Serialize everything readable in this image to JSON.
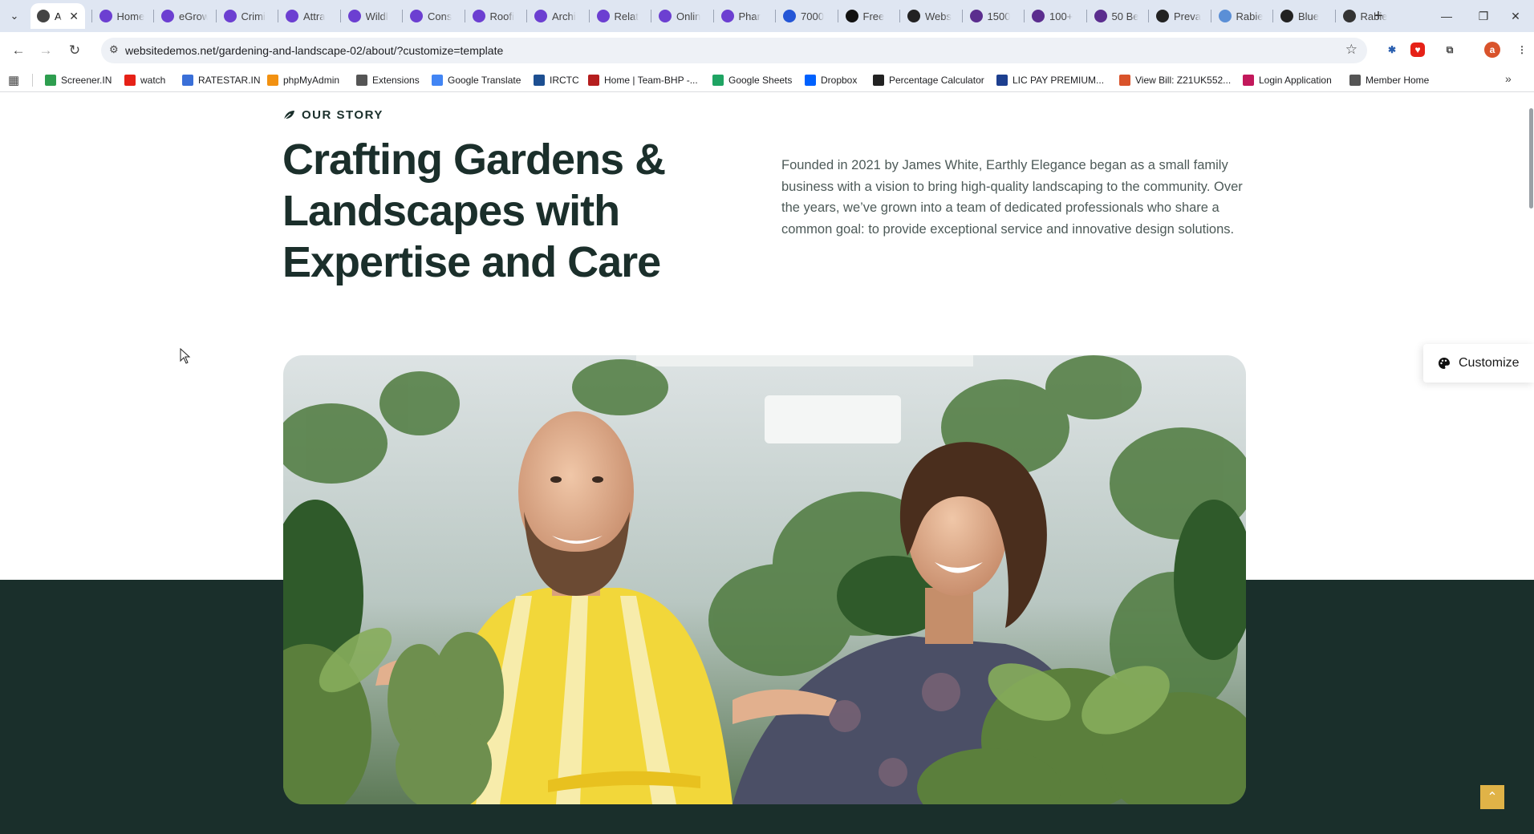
{
  "browser": {
    "tabs": [
      {
        "label": "A",
        "favicon": "active-page-icon",
        "color": "#444444",
        "active": true
      },
      {
        "label": "Home",
        "favicon": "astra-icon",
        "color": "#6c3fd1"
      },
      {
        "label": "eGrow",
        "favicon": "astra-icon",
        "color": "#6c3fd1"
      },
      {
        "label": "Crimi",
        "favicon": "astra-icon",
        "color": "#6c3fd1"
      },
      {
        "label": "Attra",
        "favicon": "astra-icon",
        "color": "#6c3fd1"
      },
      {
        "label": "Wildl",
        "favicon": "astra-icon",
        "color": "#6c3fd1"
      },
      {
        "label": "Cons",
        "favicon": "astra-icon",
        "color": "#6c3fd1"
      },
      {
        "label": "Roofi",
        "favicon": "astra-icon",
        "color": "#6c3fd1"
      },
      {
        "label": "Archi",
        "favicon": "astra-icon",
        "color": "#6c3fd1"
      },
      {
        "label": "Relat",
        "favicon": "astra-icon",
        "color": "#6c3fd1"
      },
      {
        "label": "Onlin",
        "favicon": "astra-icon",
        "color": "#6c3fd1"
      },
      {
        "label": "Phar",
        "favicon": "astra-icon",
        "color": "#6c3fd1"
      },
      {
        "label": "7000",
        "favicon": "w-square-icon",
        "color": "#2456d6"
      },
      {
        "label": "Free",
        "favicon": "framer-icon",
        "color": "#111111"
      },
      {
        "label": "Webs",
        "favicon": "wix-icon",
        "color": "#222222"
      },
      {
        "label": "1500",
        "favicon": "purple-square-icon",
        "color": "#5b2d8e"
      },
      {
        "label": "100+",
        "favicon": "purple-square-icon",
        "color": "#5b2d8e"
      },
      {
        "label": "50 Be",
        "favicon": "purple-square-icon",
        "color": "#5b2d8e"
      },
      {
        "label": "Preva",
        "favicon": "wikipedia-icon",
        "color": "#222222"
      },
      {
        "label": "Rabie",
        "favicon": "globe-hands-icon",
        "color": "#5b8fd6"
      },
      {
        "label": "Blue",
        "favicon": "wikipedia-icon",
        "color": "#222222"
      },
      {
        "label": "Rabie",
        "favicon": "openai-icon",
        "color": "#333333"
      }
    ],
    "active_tab_close": "✕",
    "new_tab": "+",
    "window_controls": {
      "minimize": "—",
      "restore": "❐",
      "close": "✕"
    },
    "url": "websitedemos.net/gardening-and-landscape-02/about/?customize=template",
    "profile_initial": "a",
    "bookmarks": [
      {
        "label": "Screener.IN",
        "icon": "bar-chart-icon",
        "color": "#2e9e4f"
      },
      {
        "label": "watch",
        "icon": "youtube-icon",
        "color": "#e62117"
      },
      {
        "label": "RATESTAR.IN",
        "icon": "star-burst-icon",
        "color": "#3a6fd8"
      },
      {
        "label": "phpMyAdmin",
        "icon": "phpmyadmin-icon",
        "color": "#f29111"
      },
      {
        "label": "Extensions",
        "icon": "puzzle-icon",
        "color": "#555555"
      },
      {
        "label": "Google Translate",
        "icon": "translate-icon",
        "color": "#4285f4"
      },
      {
        "label": "IRCTC",
        "icon": "irctc-icon",
        "color": "#1d4f91"
      },
      {
        "label": "Home | Team-BHP -...",
        "icon": "team-bhp-icon",
        "color": "#b51e1e"
      },
      {
        "label": "Google Sheets",
        "icon": "sheets-icon",
        "color": "#1fa463"
      },
      {
        "label": "Dropbox",
        "icon": "dropbox-icon",
        "color": "#0061fe"
      },
      {
        "label": "Percentage Calculator",
        "icon": "percent-icon",
        "color": "#222222"
      },
      {
        "label": "LIC PAY PREMIUM...",
        "icon": "lic-icon",
        "color": "#1d3f8f"
      },
      {
        "label": "View Bill: Z21UK552...",
        "icon": "bill-icon",
        "color": "#d9532b"
      },
      {
        "label": "Login Application",
        "icon": "login-icon",
        "color": "#c2185b"
      },
      {
        "label": "Member Home",
        "icon": "globe-icon",
        "color": "#555555"
      }
    ]
  },
  "page": {
    "eyebrow": "OUR STORY",
    "heading": "Crafting Gardens & Landscapes with Expertise and Care",
    "story": "Founded in 2021 by James White, Earthly Elegance began as a small family business with a vision to bring high-quality landscaping to the community. Over the years, we’ve grown into a team of dedicated professionals who share a common goal: to provide exceptional service and innovative design solutions.",
    "customize_label": "Customize",
    "colors": {
      "dark_green": "#1a2f2b",
      "accent": "#e0b347",
      "text_muted": "#4d5a58"
    }
  }
}
